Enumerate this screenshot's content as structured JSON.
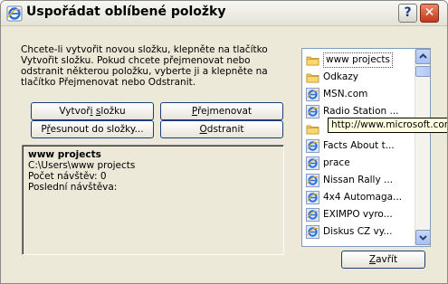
{
  "window": {
    "title": "Uspořádat oblíbené položky",
    "help_label": "?",
    "close_label": "✕"
  },
  "instruction": "Chcete-li vytvořit novou složku, klepněte na tlačítko Vytvořit složku. Pokud chcete přejmenovat nebo odstranit některou položku, vyberte ji a klepněte na tlačítko Přejmenovat nebo Odstranit.",
  "buttons": {
    "create_folder": {
      "pre": "Vytvoř",
      "key": "i",
      "post": " ",
      "key2": "s",
      "post2": "ložku"
    },
    "rename": {
      "pre": "",
      "key": "P",
      "post": "řejmenovat"
    },
    "move": {
      "pre": "P",
      "key": "ř",
      "post": "esunout do složky..."
    },
    "delete": {
      "pre": "",
      "key": "O",
      "post": "dstranit"
    },
    "close": {
      "pre": "",
      "key": "Z",
      "post": "avřít"
    }
  },
  "info": {
    "name": "www projects",
    "path": "C:\\Users\\www projects",
    "visits": "Počet návštěv: 0",
    "last_visit": "Poslední návštěva:"
  },
  "favorites": {
    "items": [
      {
        "label": "www projects",
        "icon": "folder-icon",
        "selected": true
      },
      {
        "label": "Odkazy",
        "icon": "folder-icon"
      },
      {
        "label": "MSN.com",
        "icon": "ie-page-icon"
      },
      {
        "label": "Radio Station ...",
        "icon": "ie-page-icon"
      },
      {
        "label": "",
        "icon": "folder-icon"
      },
      {
        "label": "Facts About t...",
        "icon": "ie-page-icon"
      },
      {
        "label": "prace",
        "icon": "ie-page-icon"
      },
      {
        "label": "Nissan Rally ...",
        "icon": "ie-page-icon"
      },
      {
        "label": "4x4 Automaga...",
        "icon": "ie-page-icon"
      },
      {
        "label": "EXIMPO vyro...",
        "icon": "ie-page-icon"
      },
      {
        "label": "Diskus  CZ vy...",
        "icon": "ie-page-icon"
      }
    ],
    "tooltip": "http://www.microsoft.com"
  },
  "colors": {
    "dialog_bg": "#ece9d8",
    "button_border": "#1c3d7a",
    "list_border": "#7f9db9",
    "close_button": "#c4371a",
    "folder": "#f3c84b",
    "ie_blue": "#2a6fd6"
  }
}
